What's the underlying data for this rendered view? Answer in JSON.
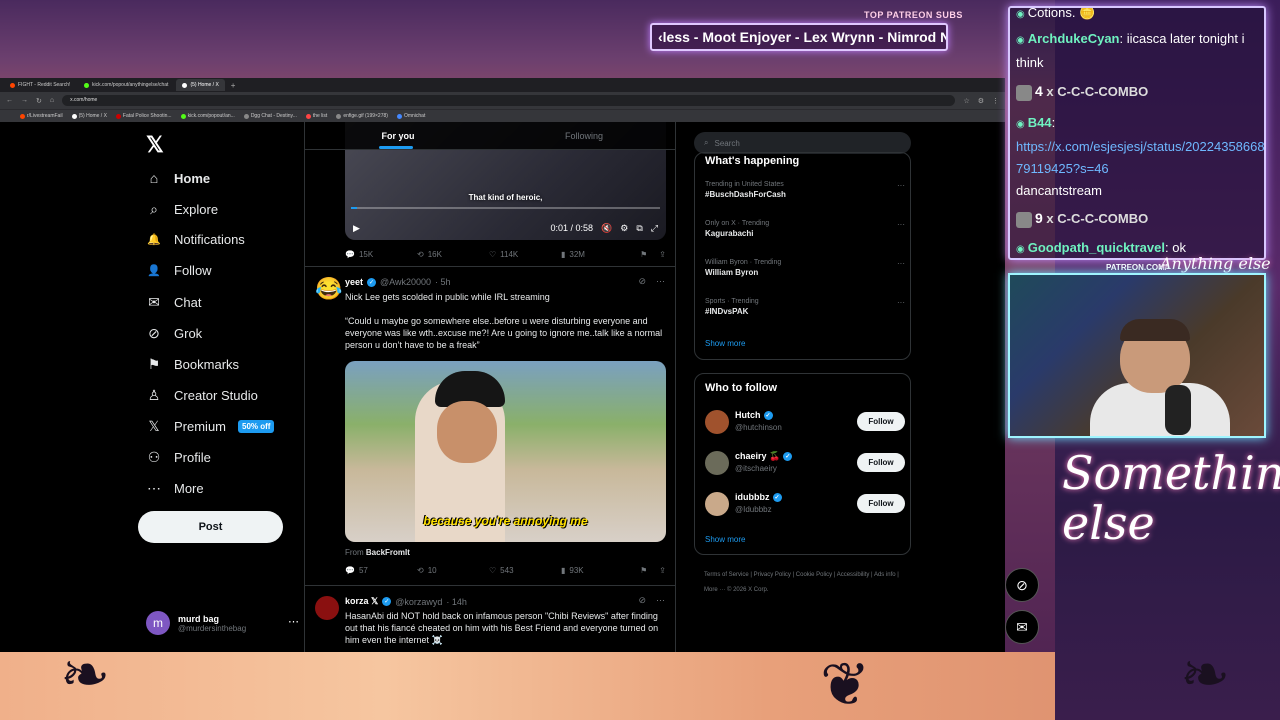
{
  "overlay": {
    "patreon_label": "TOP PATREON SUBS",
    "patreon_ticker": "‹less - Moot Enjoyer - Lex Wrynn - Nimrod Nir -",
    "patreon_url": "PATREON.COM/",
    "signature_top": "Anything else",
    "signature_main": "Something else"
  },
  "browser": {
    "tabs": [
      {
        "label": "FIGHT - Reddit Search!",
        "color": "#ff4500",
        "active": false
      },
      {
        "label": "kick.com/popout/anythingelse/chat",
        "color": "#53fc18",
        "active": false
      },
      {
        "label": "(5) Home / X",
        "color": "#ffffff",
        "active": true
      }
    ],
    "url": "x.com/home",
    "bookmarks": [
      {
        "label": "r/LivestreamFail",
        "color": "#ff4500"
      },
      {
        "label": "(5) Home / X",
        "color": "#ffffff"
      },
      {
        "label": "Fatal Police Shootin...",
        "color": "#cc0000"
      },
      {
        "label": "kick.com/popout/an...",
        "color": "#53fc18"
      },
      {
        "label": "Dgg Chat - Destiny...",
        "color": "#888888"
      },
      {
        "label": "the list",
        "color": "#ff4444"
      },
      {
        "label": "enfige.gif (199×278)",
        "color": "#888888"
      },
      {
        "label": "Omnichat",
        "color": "#4488ff"
      }
    ]
  },
  "x": {
    "logo": "𝕏",
    "nav": [
      {
        "icon": "⌂",
        "label": "Home",
        "bold": true
      },
      {
        "icon": "⌕",
        "label": "Explore"
      },
      {
        "icon": "🔔",
        "label": "Notifications"
      },
      {
        "icon": "👤",
        "label": "Follow"
      },
      {
        "icon": "✉",
        "label": "Chat"
      },
      {
        "icon": "⊘",
        "label": "Grok"
      },
      {
        "icon": "⚑",
        "label": "Bookmarks"
      },
      {
        "icon": "♙",
        "label": "Creator Studio"
      },
      {
        "icon": "𝕏",
        "label": "Premium",
        "badge": "50% off"
      },
      {
        "icon": "⚇",
        "label": "Profile"
      },
      {
        "icon": "⋯",
        "label": "More"
      }
    ],
    "post_button": "Post",
    "account": {
      "initial": "m",
      "name": "murd bag",
      "handle": "@murdersinthebag",
      "more": "⋯"
    },
    "feed_tabs": {
      "for_you": "For you",
      "following": "Following"
    },
    "video1": {
      "caption": "That kind of heroic,",
      "time": "0:01 / 0:58",
      "progress": 0.02,
      "stats": {
        "replies": "15K",
        "reposts": "16K",
        "likes": "114K",
        "views": "32M"
      }
    },
    "tweet2": {
      "name": "yeet",
      "handle": "@Awk20000",
      "age": "· 5h",
      "avatar_emoji": "😂",
      "title": "Nick Lee gets scolded in public while IRL streaming",
      "body": "“Could u maybe go somewhere else..before u were disturbing everyone and everyone was like wth..excuse me?! Are u going to ignore me..talk like a normal person u don’t have to be a freak”",
      "media_caption": "because you're annoying me",
      "from_label": "From",
      "from_name": "BackFromIt",
      "stats": {
        "replies": "57",
        "reposts": "10",
        "likes": "543",
        "views": "93K"
      }
    },
    "tweet3": {
      "name": "korza 𝕏",
      "handle": "@korzawyd",
      "age": "· 14h",
      "body": "HasanAbi did NOT hold back on infamous person \"Chibi Reviews\" after finding out that his fiancé cheated on him with his Best Friend and everyone turned on him even the internet ☠️"
    },
    "search_placeholder": "Search",
    "happening": {
      "title": "What's happening",
      "trends": [
        {
          "meta": "Trending in United States",
          "name": "#BuschDashForCash"
        },
        {
          "meta": "Only on X · Trending",
          "name": "Kagurabachi"
        },
        {
          "meta": "William Byron · Trending",
          "name": "William Byron"
        },
        {
          "meta": "Sports · Trending",
          "name": "#INDvsPAK"
        }
      ],
      "show_more": "Show more"
    },
    "who_to_follow": {
      "title": "Who to follow",
      "users": [
        {
          "name": "Hutch",
          "handle": "@hutchinson",
          "button": "Follow",
          "color": "#a0522d"
        },
        {
          "name": "chaeiry 🍒",
          "handle": "@itschaeiry",
          "button": "Follow",
          "color": "#6b6b5a"
        },
        {
          "name": "idubbbz",
          "handle": "@Idubbbz",
          "button": "Follow",
          "color": "#c9a98a"
        }
      ],
      "show_more": "Show more"
    },
    "footer": "Terms of Service  |  Privacy Policy  |  Cookie Policy  |  Accessibility  |  Ads info  |  More ···  © 2026 X Corp."
  },
  "chat": {
    "lines": [
      {
        "user": "",
        "text": "Cotions. 🪙",
        "partial": true
      },
      {
        "user": "ArchdukeCyan",
        "text": ": iicasca later tonight i think"
      },
      {
        "combo_count": "4",
        "combo": "C-C-C-COMBO"
      },
      {
        "user": "B44",
        "text": ":",
        "link": "https://x.com/esjesjesj/status/2022435866879119425?s=46",
        "after": "dancantstream"
      },
      {
        "combo_count": "9",
        "combo": "C-C-C-COMBO"
      },
      {
        "user": "Goodpath_quicktravel",
        "text": ": ok"
      }
    ]
  }
}
